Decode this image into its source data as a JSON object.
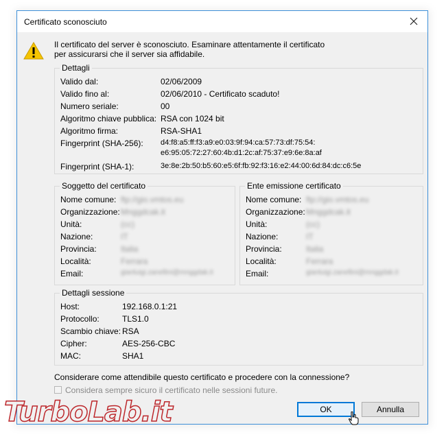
{
  "window": {
    "title": "Certificato sconosciuto",
    "message_line1": "Il certificato del server è sconosciuto. Esaminare attentamente il certificato",
    "message_line2": "per assicurarsi che il server sia affidabile."
  },
  "details": {
    "title": "Dettagli",
    "valid_from_label": "Valido dal:",
    "valid_from": "02/06/2009",
    "valid_to_label": "Valido fino al:",
    "valid_to": "02/06/2010 - Certificato scaduto!",
    "serial_label": "Numero seriale:",
    "serial": "00",
    "pubkey_label": "Algoritmo chiave pubblica:",
    "pubkey": "RSA con 1024 bit",
    "sig_label": "Algoritmo firma:",
    "sig": "RSA-SHA1",
    "fp256_label": "Fingerprint (SHA-256):",
    "fp256_line1": "d4:f8:a5:ff:f3:a9:e0:03:9f:94:ca:57:73:df:75:54:",
    "fp256_line2": "e6:95:05:72:27:60:4b:d1:2c:af:75:37:e9:6e:8a:af",
    "fp1_label": "Fingerprint (SHA-1):",
    "fp1": "3e:8e:2b:50:b5:60:e5:6f:fb:92:f3:16:e2:44:00:6d:84:dc:c6:5e"
  },
  "subject": {
    "title": "Soggetto del certificato",
    "cn_label": "Nome comune:",
    "cn": "ftp://gio.vmtos.eu",
    "org_label": "Organizzazione:",
    "org": "Mnggdcak.it",
    "unit_label": "Unità:",
    "unit": "(cc)",
    "nation_label": "Nazione:",
    "nation": "IT",
    "province_label": "Provincia:",
    "province": "Italia",
    "locality_label": "Località:",
    "locality": "Ferrara",
    "email_label": "Email:",
    "email": "gianluigi.zanellini@mnggdak.it"
  },
  "issuer": {
    "title": "Ente emissione certificato",
    "cn_label": "Nome comune:",
    "cn": "ftp://gio.vmtos.eu",
    "org_label": "Organizzazione:",
    "org": "Mnggdcak.it",
    "unit_label": "Unità:",
    "unit": "(cc)",
    "nation_label": "Nazione:",
    "nation": "IT",
    "province_label": "Provincia:",
    "province": "Italia",
    "locality_label": "Località:",
    "locality": "Ferrara",
    "email_label": "Email:",
    "email": "gianluigi.zanellini@mnggdak.it"
  },
  "session": {
    "title": "Dettagli sessione",
    "host_label": "Host:",
    "host": "192.168.0.1:21",
    "protocol_label": "Protocollo:",
    "protocol": "TLS1.0",
    "kex_label": "Scambio chiave:",
    "kex": "RSA",
    "cipher_label": "Cipher:",
    "cipher": "AES-256-CBC",
    "mac_label": "MAC:",
    "mac": "SHA1"
  },
  "question": "Considerare come attendibile questo certificato e procedere con la connessione?",
  "always_trust_label": "Considera sempre sicuro il certificato nelle sessioni future.",
  "buttons": {
    "ok": "OK",
    "cancel": "Annulla"
  },
  "watermark": "TurboLab.it",
  "colors": {
    "accent": "#0078d7",
    "border": "#3d8fd8",
    "warning": "#f5c400",
    "watermark": "#b8161b"
  },
  "icons": {
    "close": "close-icon",
    "warning": "warning-icon",
    "cursor": "mouse-cursor-icon"
  }
}
